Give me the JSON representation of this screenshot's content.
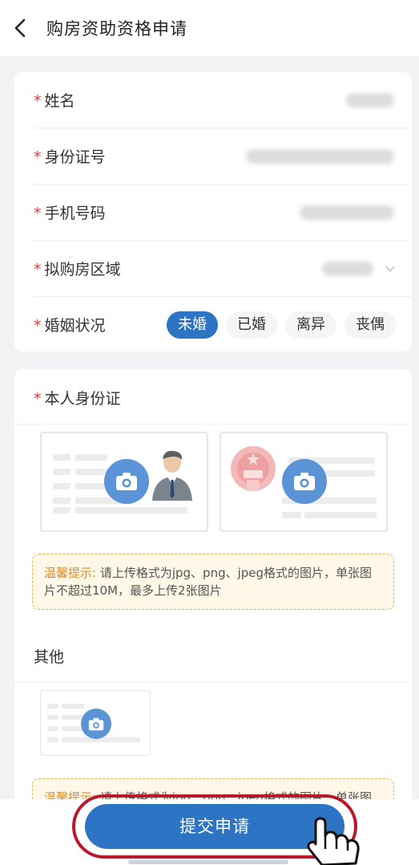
{
  "header": {
    "title": "购房资助资格申请",
    "back_icon": "chevron-left-icon"
  },
  "form": {
    "required_mark": "*",
    "name_label": "姓名",
    "id_label": "身份证号",
    "phone_label": "手机号码",
    "area_label": "拟购房区域",
    "marital_label": "婚姻状况",
    "marital_options": [
      "未婚",
      "已婚",
      "离异",
      "丧偶"
    ],
    "marital_selected": "未婚"
  },
  "upload": {
    "id_section_title": "本人身份证",
    "tip_title": "温馨提示:",
    "tip_body": " 请上传格式为jpg、png、jpeg格式的图片，单张图片不超过10M，最多上传2张图片",
    "other_title": "其他"
  },
  "footer": {
    "submit_label": "提交申请"
  },
  "colors": {
    "accent": "#2d74c4",
    "required": "#d83b3b",
    "tip_border": "#e8b45a",
    "highlight_ring": "#b8182a"
  }
}
